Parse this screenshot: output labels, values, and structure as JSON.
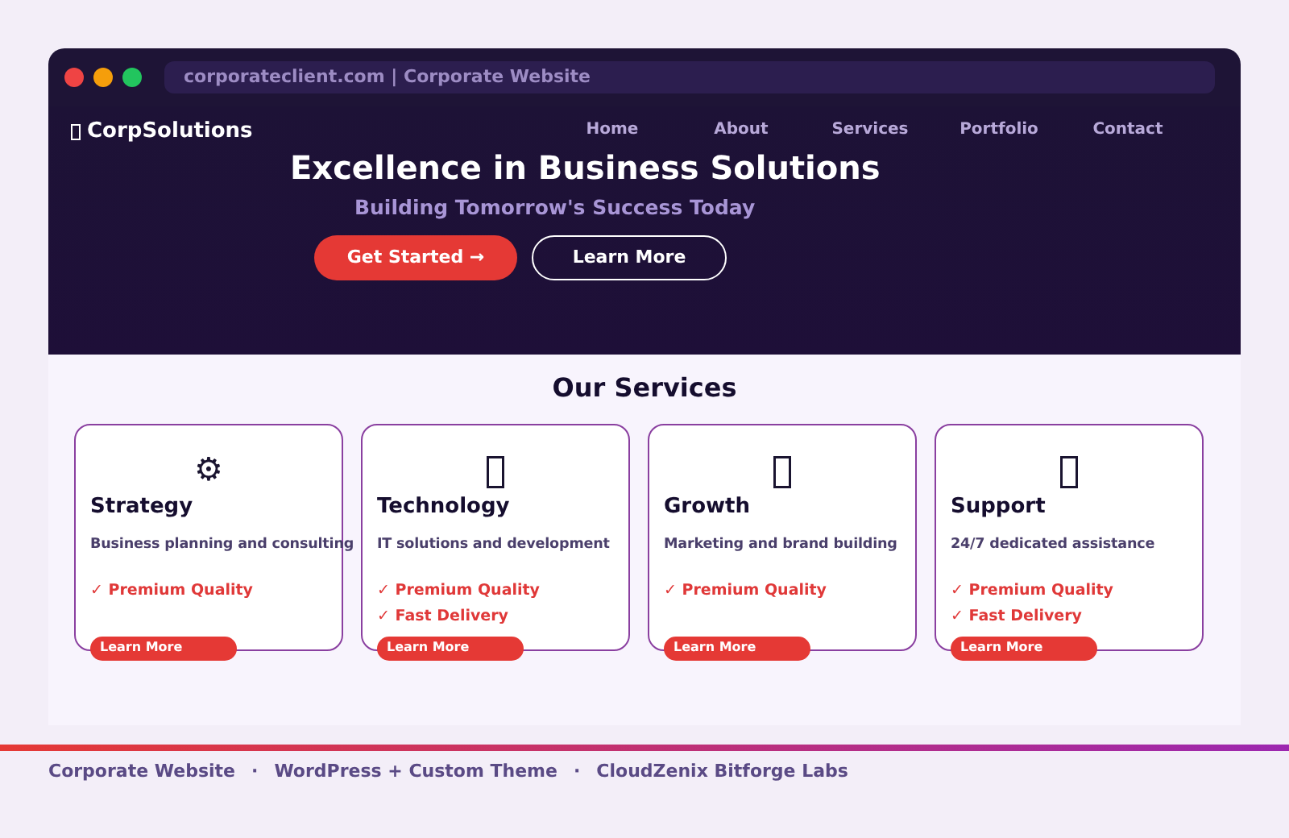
{
  "browser": {
    "address": "corporateclient.com | Corporate Website"
  },
  "navbar": {
    "brand": "CorpSolutions",
    "links": [
      "Home",
      "About",
      "Services",
      "Portfolio",
      "Contact"
    ]
  },
  "hero": {
    "title": "Excellence in Business Solutions",
    "subtitle": "Building Tomorrow's Success Today",
    "buttons": [
      {
        "label": "Get Started →",
        "kind": "primary"
      },
      {
        "label": "Learn More",
        "kind": "outline"
      }
    ]
  },
  "services": {
    "heading": "Our Services",
    "cards": [
      {
        "icon": "⚙",
        "title": "Strategy",
        "description": "Business planning and consulting",
        "features": [
          "✓ Premium Quality"
        ],
        "button": "Learn More"
      },
      {
        "title": "Technology",
        "description": "IT solutions and development",
        "features": [
          "✓ Premium Quality",
          "✓ Fast Delivery"
        ],
        "button": "Learn More"
      },
      {
        "title": "Growth",
        "description": "Marketing and brand building",
        "features": [
          "✓ Premium Quality"
        ],
        "button": "Learn More"
      },
      {
        "title": "Support",
        "description": "24/7 dedicated assistance",
        "features": [
          "✓ Premium Quality",
          "✓ Fast Delivery"
        ],
        "button": "Learn More"
      }
    ]
  },
  "footer": {
    "separator": "·",
    "items": [
      "Corporate Website",
      "WordPress + Custom Theme",
      "CloudZenix Bitforge Labs"
    ]
  }
}
